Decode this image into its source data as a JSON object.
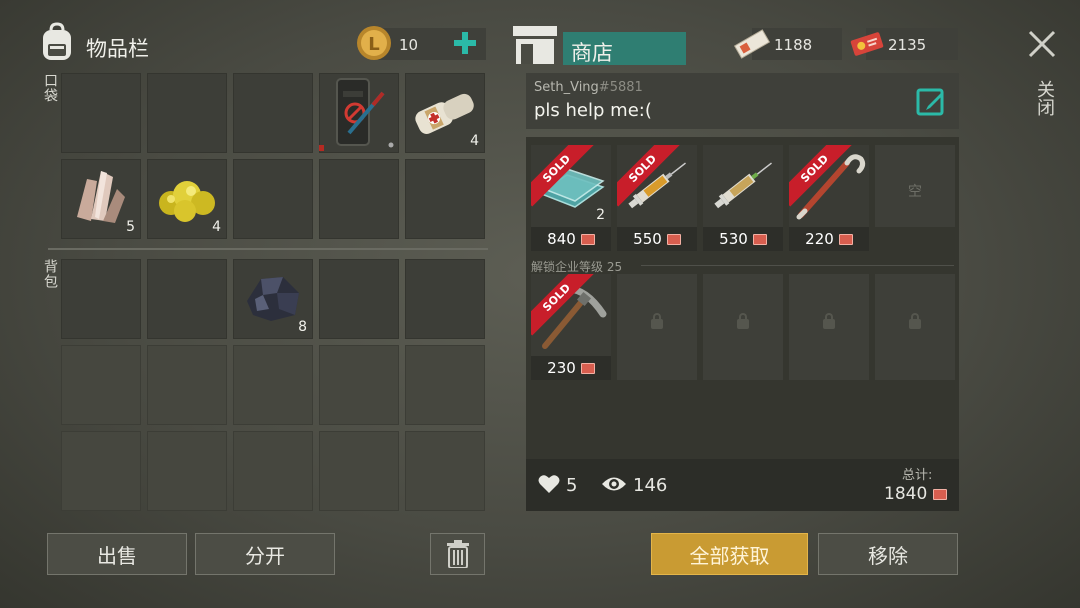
{
  "inventory": {
    "title": "物品栏",
    "coins": "10",
    "pocket_label": "口袋",
    "backpack_label": "背包",
    "pocket_items": [
      {
        "name": "quartz-crystal",
        "count": "5"
      },
      {
        "name": "sulfur-ore",
        "count": "4"
      }
    ],
    "top_items": [
      {
        "name": "knife-sheath",
        "count": ""
      },
      {
        "name": "bandage",
        "count": "4"
      }
    ],
    "backpack_items": [
      {
        "name": "coal-ore",
        "count": "8"
      }
    ],
    "sell_label": "出售",
    "split_label": "分开"
  },
  "shop": {
    "title": "商店",
    "currency1": "1188",
    "currency2": "2135",
    "seller": "Seth_Ving",
    "seller_tag": "#5881",
    "message": "pls help me:(",
    "sold_label": "SOLD",
    "empty_label": "空",
    "unlock_text": "解锁企业等级 25",
    "items": [
      {
        "name": "glass-sheets",
        "price": "840",
        "count": "2",
        "sold": true
      },
      {
        "name": "syringe-orange",
        "price": "550",
        "count": "",
        "sold": true
      },
      {
        "name": "syringe-green",
        "price": "530",
        "count": "",
        "sold": false
      },
      {
        "name": "crowbar",
        "price": "220",
        "count": "",
        "sold": true
      },
      {
        "name": "pickaxe",
        "price": "230",
        "count": "",
        "sold": true
      }
    ],
    "likes": "5",
    "views": "146",
    "total_label": "总计:",
    "total_value": "1840",
    "take_all_label": "全部获取",
    "remove_label": "移除"
  },
  "close_label": "关闭",
  "colors": {
    "accent": "#2bbaa8",
    "gold": "#c99b33",
    "sold": "#c81e2a"
  }
}
